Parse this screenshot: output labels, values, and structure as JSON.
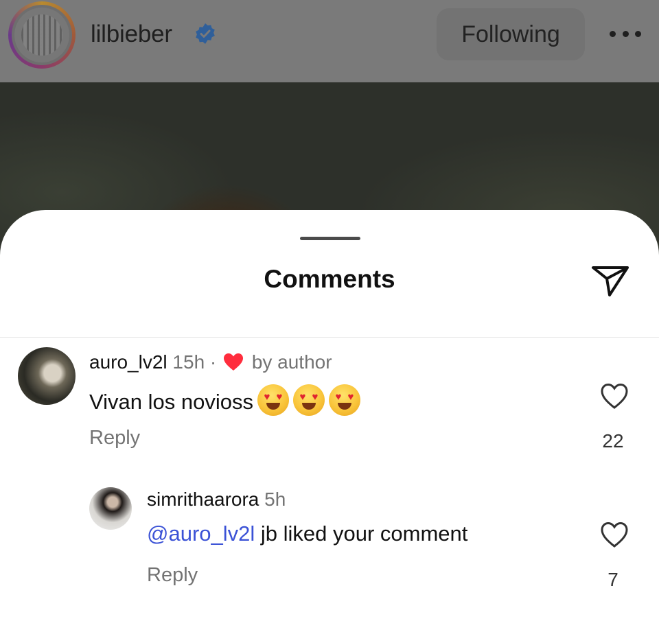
{
  "header": {
    "username": "lilbieber",
    "follow_button": "Following"
  },
  "sheet": {
    "title": "Comments"
  },
  "comments": [
    {
      "username": "auro_lv2l",
      "time": "15h",
      "separator": "·",
      "liked_by": "by author",
      "text": "Vivan los novioss",
      "emojis": [
        "heart-eyes-emoji",
        "heart-eyes-emoji",
        "heart-eyes-emoji"
      ],
      "reply_label": "Reply",
      "like_count": "22"
    },
    {
      "username": "simrithaarora",
      "time": "5h",
      "mention": "@auro_lv2l",
      "text": " jb liked your comment",
      "reply_label": "Reply",
      "like_count": "7"
    }
  ],
  "colors": {
    "verified": "#3b82f6",
    "author_heart": "#ff2d3d",
    "mention": "#3b52d6",
    "overlay_header": "#7a7a7a"
  }
}
